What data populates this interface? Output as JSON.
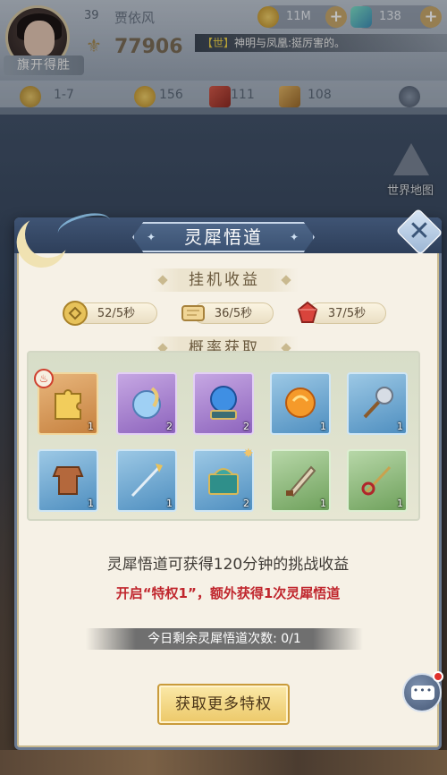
{
  "player": {
    "level": "39",
    "name": "贾依风",
    "title": "旗开得胜",
    "power": "77906"
  },
  "resources": {
    "coins": "11M",
    "gems": "138"
  },
  "notice": {
    "tag": "【世】",
    "text": "神明与凤凰:挺厉害的。"
  },
  "stats": {
    "stage": "1-7",
    "gold_rate": "156",
    "scroll": "111",
    "book": "108"
  },
  "world_map_label": "世界地图",
  "dialog": {
    "title": "灵犀悟道",
    "income_section": "挂机收益",
    "income": [
      {
        "icon": "gold-coin-icon",
        "value": "52/5秒"
      },
      {
        "icon": "exp-scroll-icon",
        "value": "36/5秒"
      },
      {
        "icon": "red-gem-icon",
        "value": "37/5秒"
      }
    ],
    "drop_section": "概率获取",
    "items": [
      {
        "icon": "golden-puzzle-piece-icon",
        "quality": "orange",
        "count": "1"
      },
      {
        "icon": "spirit-orb-icon",
        "quality": "purple",
        "count": "2"
      },
      {
        "icon": "crystal-ball-icon",
        "quality": "purple",
        "count": "2"
      },
      {
        "icon": "fire-orb-icon",
        "quality": "blue",
        "count": "1"
      },
      {
        "icon": "battle-axe-icon",
        "quality": "blue",
        "count": "1"
      },
      {
        "icon": "bronze-armor-icon",
        "quality": "blue",
        "count": "1"
      },
      {
        "icon": "golden-spear-icon",
        "quality": "blue",
        "count": "1"
      },
      {
        "icon": "treasure-chest-icon",
        "quality": "blue",
        "count": "2"
      },
      {
        "icon": "short-blade-icon",
        "quality": "green",
        "count": "1"
      },
      {
        "icon": "ornate-staff-icon",
        "quality": "green",
        "count": "1"
      }
    ],
    "description": "灵犀悟道可获得120分钟的挑战收益",
    "privilege_text": "开启“特权1”，额外获得1次灵犀悟道",
    "remaining": "今日剩余灵犀悟道次数: 0/1",
    "button_label": "获取更多特权"
  },
  "chat_icon_text": "•••"
}
